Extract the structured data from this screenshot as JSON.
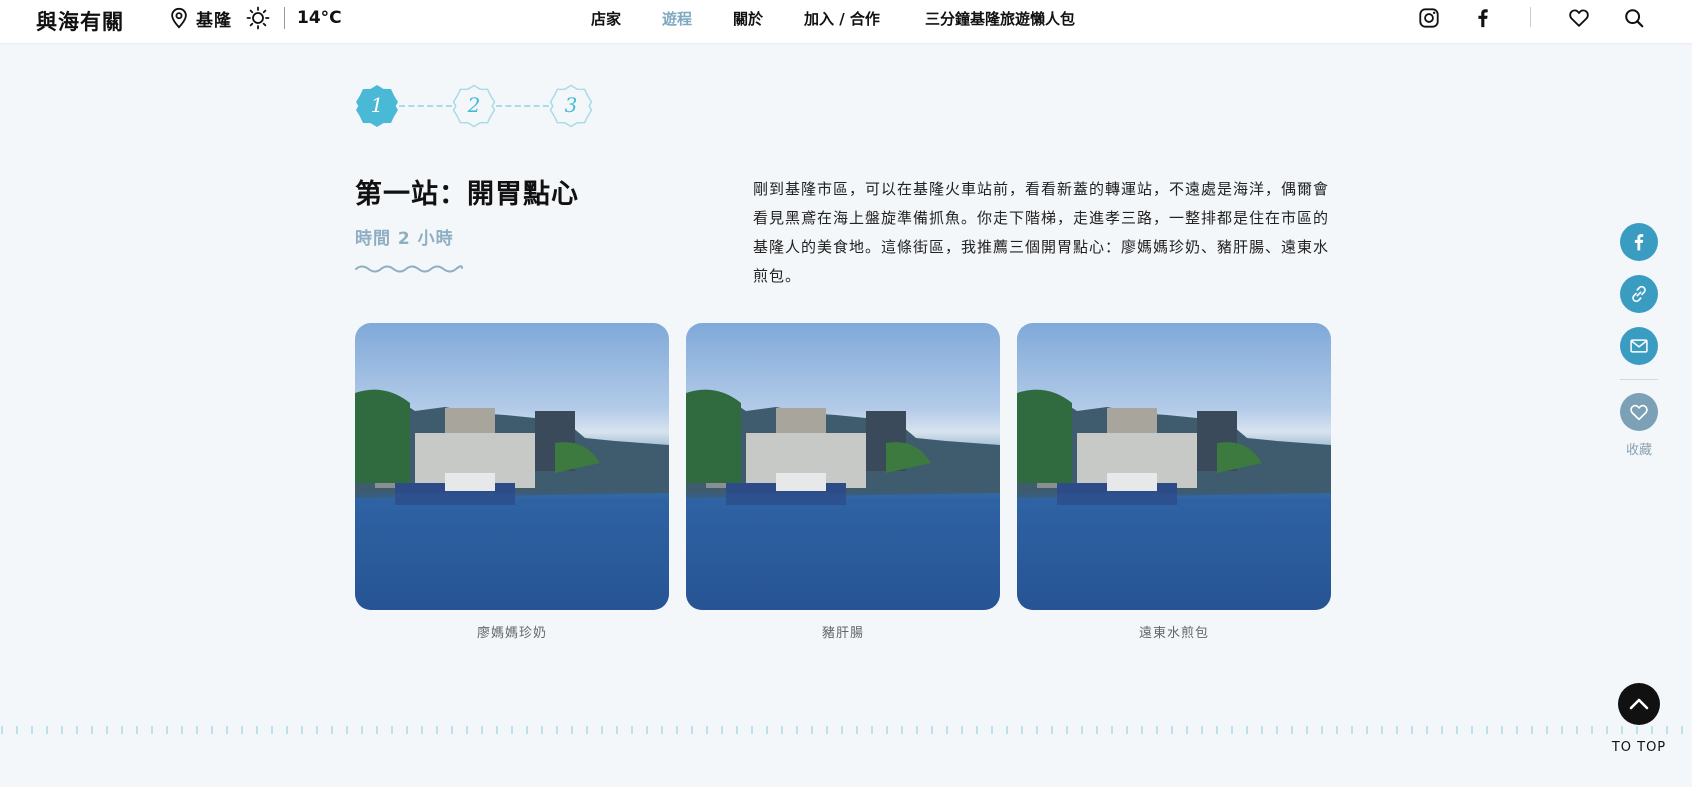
{
  "header": {
    "logo": "與海有關",
    "location": "基隆",
    "temperature": "14°C",
    "nav": [
      "店家",
      "遊程",
      "關於",
      "加入 / 合作",
      "三分鐘基隆旅遊懶人包"
    ],
    "active_nav": "遊程",
    "icons": [
      "location-pin-icon",
      "sun-icon",
      "instagram-icon",
      "facebook-icon",
      "heart-icon",
      "search-icon"
    ]
  },
  "steps": [
    "1",
    "2",
    "3"
  ],
  "current_step": "1",
  "section": {
    "title": "第一站：開胃點心",
    "duration": "時間 2 小時",
    "description": "剛到基隆市區，可以在基隆火車站前，看看新蓋的轉運站，不遠處是海洋，偶爾會看見黑鳶在海上盤旋準備抓魚。你走下階梯，走進孝三路，一整排都是住在市區的基隆人的美食地。這條街區，我推薦三個開胃點心：廖媽媽珍奶、豬肝腸、遠東水煎包。"
  },
  "photos": [
    {
      "caption": "廖媽媽珍奶"
    },
    {
      "caption": "豬肝腸"
    },
    {
      "caption": "遠東水煎包"
    }
  ],
  "share": {
    "icons": [
      "facebook-share-icon",
      "copy-link-icon",
      "mail-icon"
    ],
    "favorite_label": "收藏"
  },
  "to_top_label": "TO TOP",
  "colors": {
    "accent": "#4ab9d6",
    "share_bg": "#3b9cc2",
    "muted_blue": "#8eaec1",
    "page_bg": "#f3f7fa"
  }
}
